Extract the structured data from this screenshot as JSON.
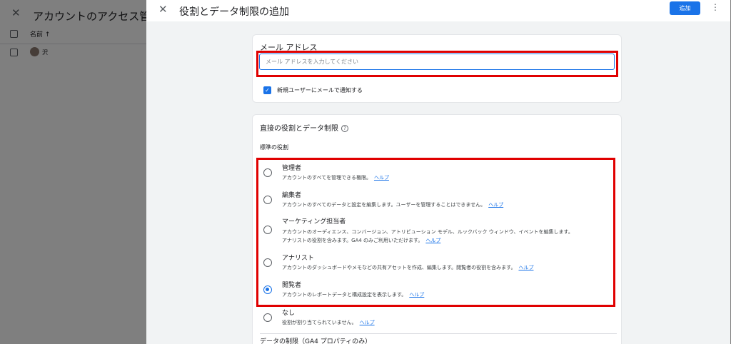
{
  "background": {
    "title": "アカウントのアクセス管理",
    "column_name": "名前 ↑",
    "row_text": "沢"
  },
  "panel": {
    "title": "役割とデータ制限の追加",
    "add_label": "追加"
  },
  "email": {
    "label": "メール アドレス",
    "placeholder": "メール アドレスを入力してください",
    "value": "",
    "notify_label": "新規ユーザーにメールで通知する",
    "notify_checked": true
  },
  "roles": {
    "title": "直接の役割とデータ制限",
    "subtitle": "標準の役割",
    "help_link": "ヘルプ",
    "items": [
      {
        "name": "管理者",
        "desc": "アカウントのすべてを管理できる権限。"
      },
      {
        "name": "編集者",
        "desc": "アカウントのすべてのデータと設定を編集します。ユーザーを管理することはできません。"
      },
      {
        "name": "マーケティング担当者",
        "desc": "アカウントのオーディエンス、コンバージョン、アトリビューション モデル、ルックバック ウィンドウ、イベントを編集します。",
        "desc2": "アナリストの役割を含みます。GA4 のみご利用いただけます。"
      },
      {
        "name": "アナリスト",
        "desc": "アカウントのダッシュボードやメモなどの共有アセットを作成、編集します。閲覧者の役割を含みます。"
      },
      {
        "name": "閲覧者",
        "desc": "アカウントのレポートデータと構成設定を表示します。"
      },
      {
        "name": "なし",
        "desc": "役割が割り当てられていません。"
      }
    ],
    "selected": "閲覧者"
  },
  "data_limits": {
    "title": "データの制限（GA4 プロパティのみ）"
  },
  "colors": {
    "accent": "#1a73e8",
    "highlight": "#e00000"
  }
}
